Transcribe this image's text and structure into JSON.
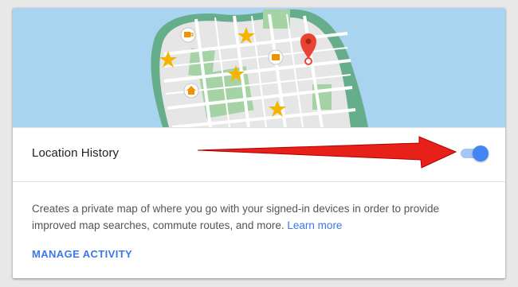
{
  "location_history": {
    "label": "Location History",
    "enabled": true,
    "description": "Creates a private map of where you go with your signed-in devices in order to provide improved map searches, commute routes, and more.",
    "learn_more_label": "Learn more",
    "manage_activity_label": "MANAGE ACTIVITY"
  },
  "colors": {
    "accent": "#4285f4",
    "link": "#3b78e7",
    "map_water": "#a8d4f0",
    "map_land": "#e6e6e6",
    "map_shore": "#66ad8c",
    "map_park": "#a5d3a6",
    "star": "#f4b400",
    "pin": "#ea4335",
    "arrow": "#e8201a"
  }
}
